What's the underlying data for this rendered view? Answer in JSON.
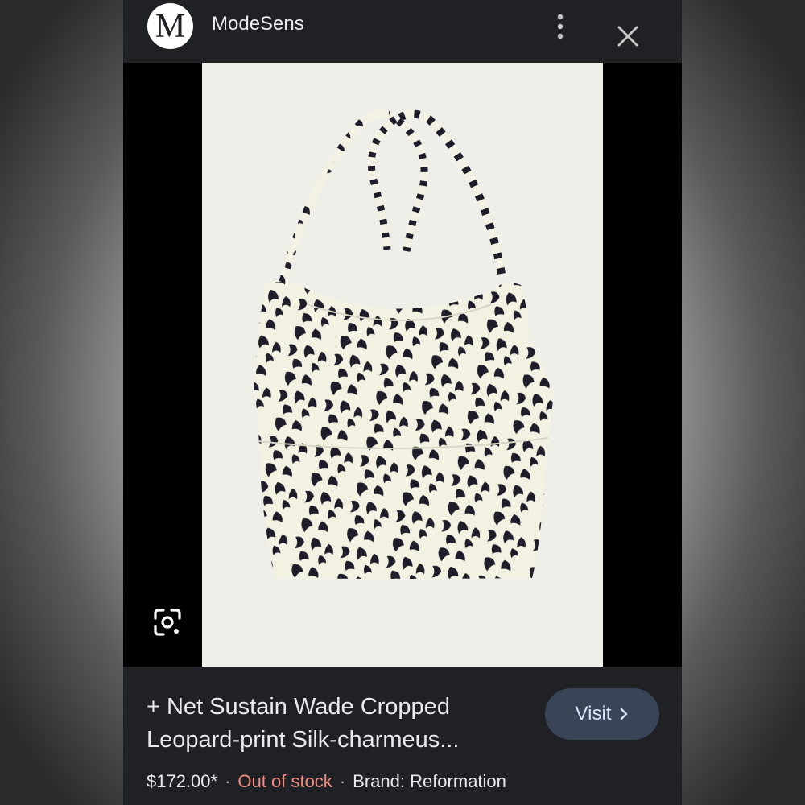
{
  "header": {
    "logo_letter": "M",
    "site_name": "ModeSens",
    "menu_icon": "more-vert-icon",
    "close_icon": "close-icon"
  },
  "image": {
    "lens_icon": "google-lens-icon"
  },
  "product": {
    "title_line1": "+ Net Sustain Wade Cropped",
    "title_line2": "Leopard-print Silk-charmeus...",
    "price": "$172.00*",
    "stock": "Out of stock",
    "brand": "Brand: Reformation",
    "separator": "·"
  },
  "visit": {
    "label": "Visit",
    "icon": "chevron-right-icon"
  },
  "colors": {
    "panel": "#202124",
    "visit_bg": "#394457",
    "visit_text": "#d2e3fc",
    "out_of_stock": "#f28b82"
  }
}
